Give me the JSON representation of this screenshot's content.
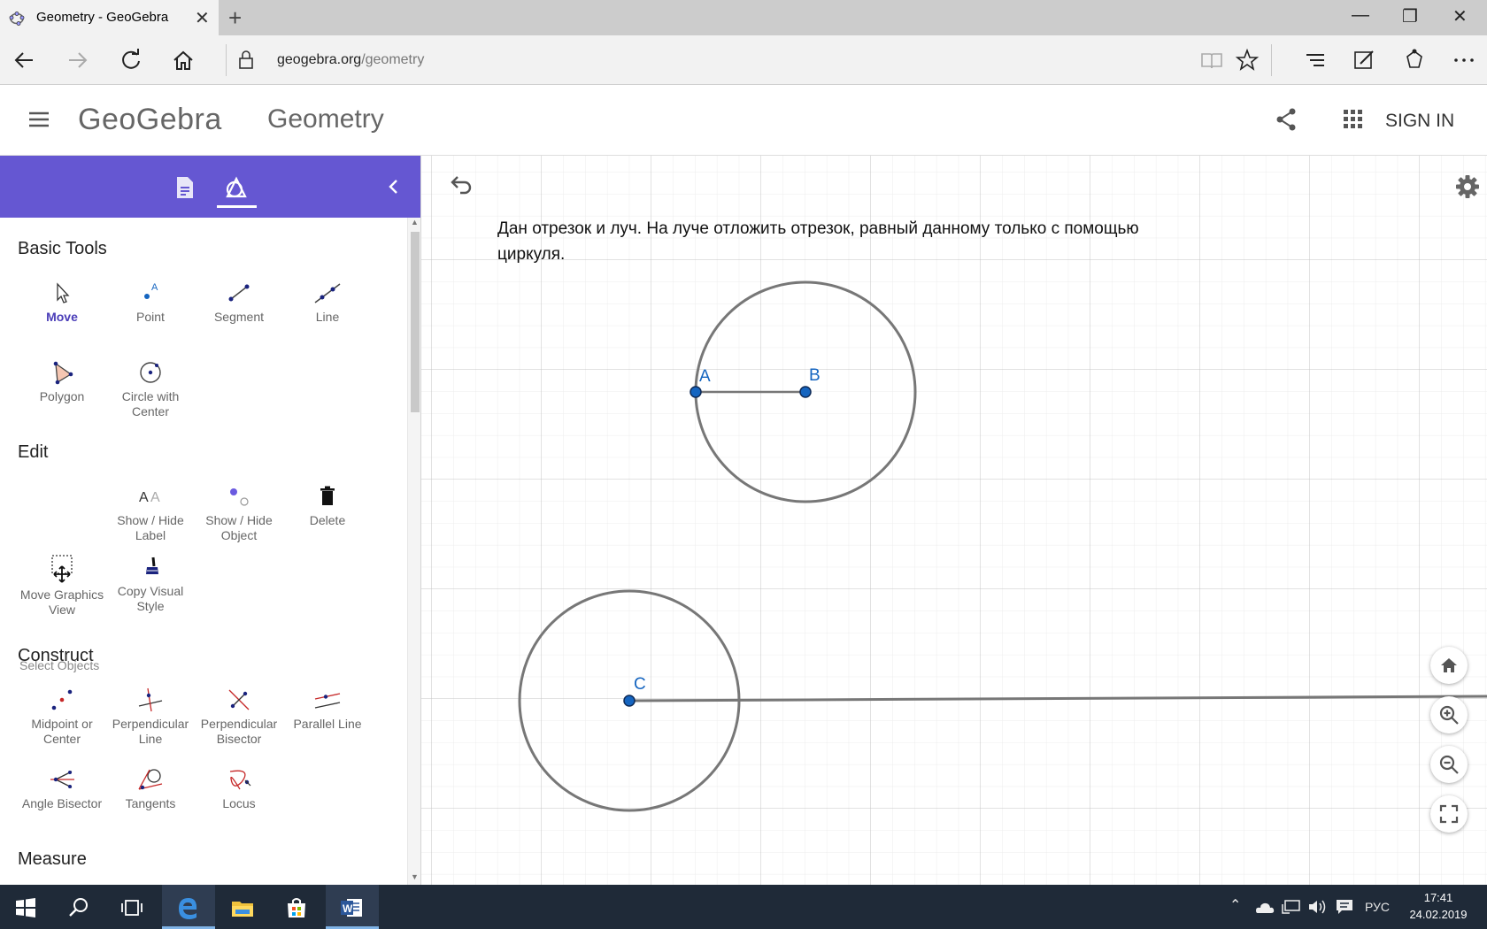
{
  "browser": {
    "tab_title": "Geometry - GeoGebra",
    "url_host": "geogebra.org",
    "url_path": "/geometry"
  },
  "app": {
    "brand": "GeoGebra",
    "title": "Geometry",
    "sign_in": "SIGN IN",
    "accent_color": "#6557d2"
  },
  "tools": {
    "categories": {
      "basic": "Basic Tools",
      "edit": "Edit",
      "construct": "Construct",
      "measure": "Measure"
    },
    "tooltip": "Select Objects",
    "basic": [
      "Move",
      "Point",
      "Segment",
      "Line"
    ],
    "basic2": [
      "Polygon",
      "Circle with Center"
    ],
    "edit": [
      "Show / Hide Label",
      "Show / Hide Object",
      "Delete"
    ],
    "edit2": [
      "Move Graphics View",
      "Copy Visual Style"
    ],
    "construct": [
      "Midpoint or Center",
      "Perpendicular Line",
      "Perpendicular Bisector",
      "Parallel Line"
    ],
    "construct2": [
      "Angle Bisector",
      "Tangents",
      "Locus"
    ]
  },
  "graphics": {
    "task_text": "Дан отрезок и луч. На луче отложить отрезок, равный данному только с помощью циркуля.",
    "points": {
      "A": "A",
      "B": "B",
      "C": "C"
    }
  },
  "taskbar": {
    "language": "РУС",
    "time": "17:41",
    "date": "24.02.2019"
  }
}
